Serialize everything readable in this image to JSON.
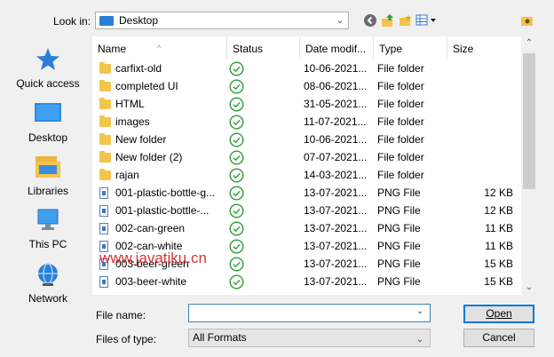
{
  "toolbar": {
    "look_in_label": "Look in:",
    "look_in_value": "Desktop"
  },
  "places": [
    {
      "label": "Quick access",
      "icon": "quick-access-star-icon"
    },
    {
      "label": "Desktop",
      "icon": "desktop-icon"
    },
    {
      "label": "Libraries",
      "icon": "libraries-icon"
    },
    {
      "label": "This PC",
      "icon": "this-pc-icon"
    },
    {
      "label": "Network",
      "icon": "network-icon"
    }
  ],
  "columns": {
    "name": "Name",
    "status": "Status",
    "date": "Date modif...",
    "type": "Type",
    "size": "Size"
  },
  "files": [
    {
      "name": "carfixt-old",
      "date": "10-06-2021...",
      "type": "File folder",
      "size": "",
      "kind": "folder"
    },
    {
      "name": "completed UI",
      "date": "08-06-2021...",
      "type": "File folder",
      "size": "",
      "kind": "folder"
    },
    {
      "name": "HTML",
      "date": "31-05-2021...",
      "type": "File folder",
      "size": "",
      "kind": "folder"
    },
    {
      "name": "images",
      "date": "11-07-2021...",
      "type": "File folder",
      "size": "",
      "kind": "folder"
    },
    {
      "name": "New folder",
      "date": "10-06-2021...",
      "type": "File folder",
      "size": "",
      "kind": "folder"
    },
    {
      "name": "New folder (2)",
      "date": "07-07-2021...",
      "type": "File folder",
      "size": "",
      "kind": "folder"
    },
    {
      "name": "rajan",
      "date": "14-03-2021...",
      "type": "File folder",
      "size": "",
      "kind": "folder"
    },
    {
      "name": "001-plastic-bottle-g...",
      "date": "13-07-2021...",
      "type": "PNG File",
      "size": "12 KB",
      "kind": "png"
    },
    {
      "name": "001-plastic-bottle-...",
      "date": "13-07-2021...",
      "type": "PNG File",
      "size": "12 KB",
      "kind": "png"
    },
    {
      "name": "002-can-green",
      "date": "13-07-2021...",
      "type": "PNG File",
      "size": "11 KB",
      "kind": "png"
    },
    {
      "name": "002-can-white",
      "date": "13-07-2021...",
      "type": "PNG File",
      "size": "11 KB",
      "kind": "png"
    },
    {
      "name": "003-beer-green",
      "date": "13-07-2021...",
      "type": "PNG File",
      "size": "15 KB",
      "kind": "png"
    },
    {
      "name": "003-beer-white",
      "date": "13-07-2021...",
      "type": "PNG File",
      "size": "15 KB",
      "kind": "png"
    }
  ],
  "bottom": {
    "file_name_label": "File name:",
    "file_name_value": "",
    "file_type_label": "Files of type:",
    "file_type_value": "All Formats",
    "open_label": "Open",
    "cancel_label": "Cancel"
  },
  "watermark": "www.javatiku.cn",
  "colors": {
    "accent": "#0078d7",
    "status_ok": "#2e9b3a",
    "folder": "#f3c44e",
    "watermark": "#d21f1f"
  }
}
